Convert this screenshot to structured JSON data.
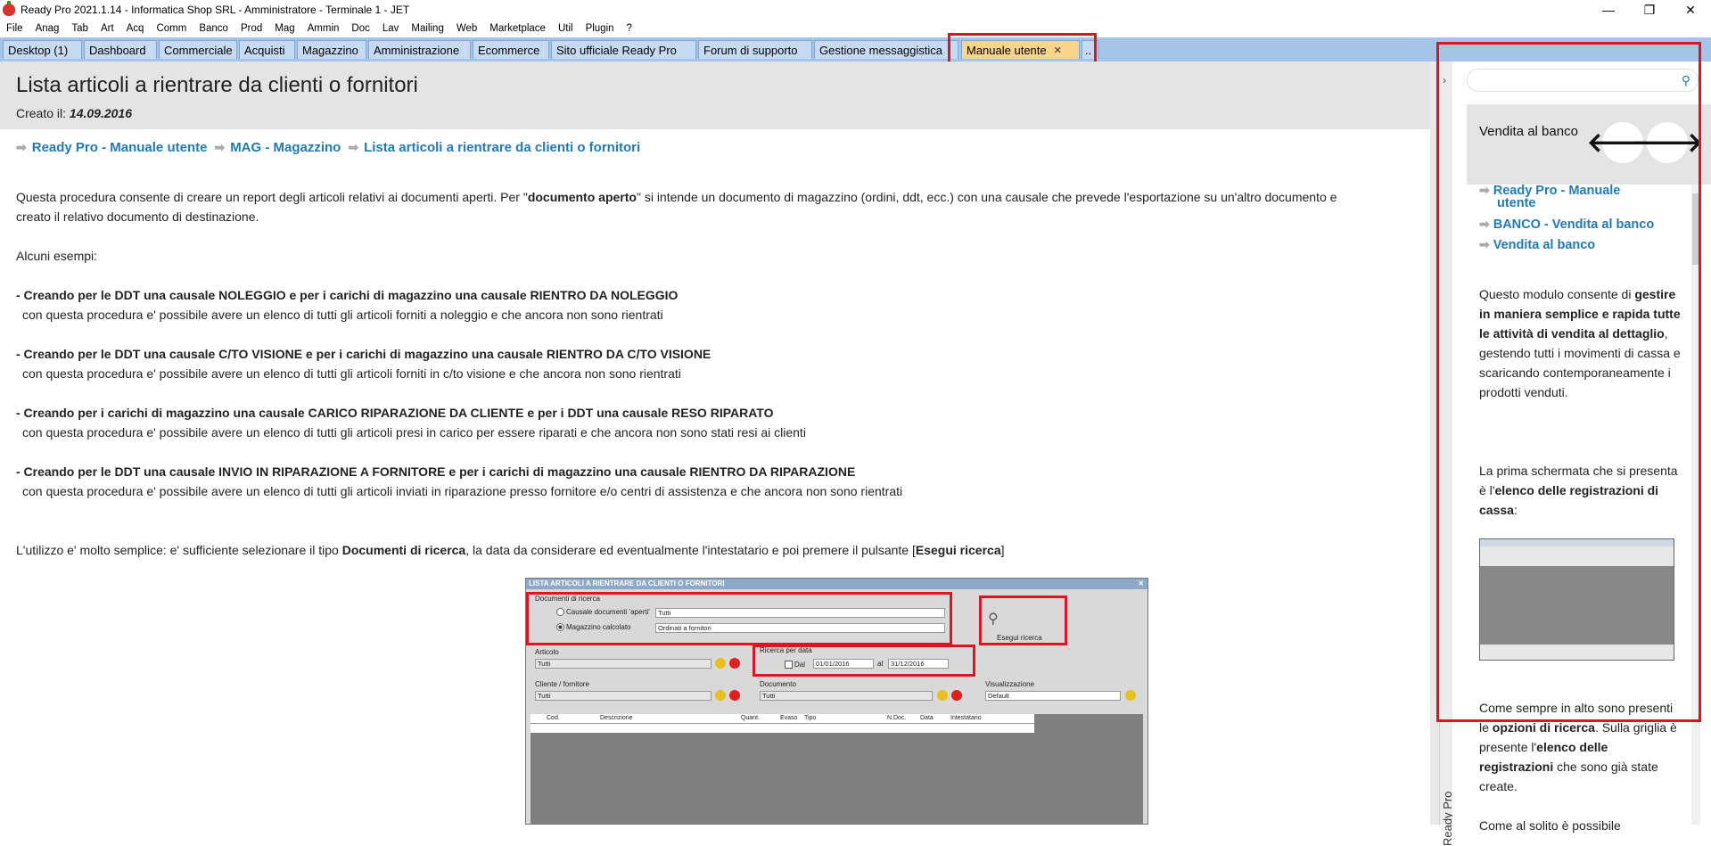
{
  "window": {
    "title": "Ready Pro 2021.1.14 - Informatica Shop SRL - Amministratore - Terminale 1 - JET",
    "min": "—",
    "max": "❐",
    "close": "✕"
  },
  "menu": [
    "File",
    "Anag",
    "Tab",
    "Art",
    "Acq",
    "Comm",
    "Banco",
    "Prod",
    "Mag",
    "Ammin",
    "Doc",
    "Lav",
    "Mailing",
    "Web",
    "Marketplace",
    "Util",
    "Plugin",
    "?"
  ],
  "tabs": [
    {
      "label": "Desktop (1)"
    },
    {
      "label": "Dashboard"
    },
    {
      "label": "Commerciale"
    },
    {
      "label": "Acquisti"
    },
    {
      "label": "Magazzino"
    },
    {
      "label": "Amministrazione"
    },
    {
      "label": "Ecommerce"
    },
    {
      "label": "Sito ufficiale Ready Pro"
    },
    {
      "label": "Forum di supporto"
    },
    {
      "label": "Gestione messaggistica"
    },
    {
      "label": "Manuale utente",
      "close": "✕"
    },
    {
      "label": ".."
    }
  ],
  "page": {
    "title": "Lista articoli a rientrare da clienti o fornitori",
    "created_label": "Creato il:",
    "created_date": "14.09.2016",
    "breadcrumb": [
      "Ready Pro - Manuale utente",
      "MAG - Magazzino",
      "Lista articoli a rientrare da clienti o fornitori"
    ],
    "intro_1a": "Questa procedura consente di creare un report degli articoli relativi ai documenti aperti. Per \"",
    "intro_1b": "documento aperto",
    "intro_1c": "\" si intende un documento di magazzino (ordini, ddt, ecc.) con una causale che prevede l'esportazione su un'altro documento e",
    "intro_2": "creato il relativo documento di destinazione.",
    "examples_label": "Alcuni esempi:",
    "examples": [
      {
        "title": "- Creando per le DDT una causale NOLEGGIO e per i carichi di magazzino una causale RIENTRO DA NOLEGGIO",
        "desc": "con questa procedura e' possibile avere un elenco di tutti gli articoli forniti a noleggio e che ancora non sono rientrati"
      },
      {
        "title": "- Creando per le DDT una causale C/TO VISIONE e per i carichi di magazzino una causale RIENTRO DA C/TO VISIONE",
        "desc": "con questa procedura e' possibile avere un elenco di tutti gli articoli forniti in c/to visione e che ancora non sono rientrati"
      },
      {
        "title": "- Creando per i carichi di magazzino una causale CARICO RIPARAZIONE DA CLIENTE e per i DDT una causale RESO RIPARATO",
        "desc": "con questa procedura e' possibile avere un elenco di tutti gli articoli presi in carico per essere riparati e che ancora non sono stati resi ai clienti"
      },
      {
        "title": "- Creando per le DDT una causale INVIO IN RIPARAZIONE A FORNITORE e per i carichi di magazzino una causale RIENTRO DA RIPARAZIONE",
        "desc": "con questa procedura e' possibile avere un elenco di tutti gli articoli inviati in riparazione presso fornitore e/o centri di assistenza e che ancora non sono rientrati"
      }
    ],
    "usage_a": "L'utilizzo e' molto semplice: e' sufficiente selezionare il tipo ",
    "usage_b": "Documenti di ricerca",
    "usage_c": ", la data da considerare ed eventualmente l'intestatario e poi premere il pulsante [",
    "usage_d": "Esegui ricerca",
    "usage_e": "]"
  },
  "screenshot": {
    "title": "LISTA ARTICOLI A RIENTRARE DA CLIENTI O FORNITORI",
    "close": "✕",
    "doc_group": "Documenti di ricerca",
    "opt_causale": "Causale documenti 'aperti'",
    "opt_causale_value": "Tutti",
    "opt_magazzino": "Magazzino calcolato",
    "opt_magazzino_value": "Ordinati a fornitori",
    "run_button": "Esegui ricerca",
    "articolo_label": "Articolo",
    "articolo_value": "Tutti",
    "date_group": "Ricerca per data",
    "dal_label": "Dal",
    "date_from": "01/01/2016",
    "al_label": "al",
    "date_to": "31/12/2016",
    "cliente_label": "Cliente / fornitore",
    "cliente_value": "Tutti",
    "documento_label": "Documento",
    "documento_value": "Tutti",
    "vis_label": "Visualizzazione",
    "vis_value": "Default",
    "columns": [
      "Cod.",
      "Descrizione",
      "Quant.",
      "Evaso",
      "Tipo",
      "N.Doc.",
      "Data",
      "Intestatario"
    ]
  },
  "right_panel": {
    "vertical_label": "Ready Pro",
    "title": "Vendita al banco",
    "prev": "🡐",
    "next": "🡒",
    "links": [
      "Ready Pro - Manuale",
      "utente",
      "BANCO - Vendita al banco",
      "Vendita al banco"
    ],
    "p1_a": "Questo modulo consente di ",
    "p1_b": "gestire in maniera semplice e rapida tutte le attività di vendita al dettaglio",
    "p1_c": ", gestendo tutti i movimenti di cassa e scaricando contemporaneamente i prodotti venduti.",
    "p2_a": "La prima schermata che si presenta è l'",
    "p2_b": "elenco delle registrazioni di cassa",
    "p2_c": ":",
    "p3_a": "Come sempre in alto sono presenti le ",
    "p3_b": "opzioni di ricerca",
    "p3_c": ". Sulla griglia è presente l'",
    "p3_d": "elenco delle registrazioni",
    "p3_e": " che sono già state create.",
    "p4": "Come al solito è possibile"
  },
  "colors": {
    "accent": "#1f7ab8",
    "highlight": "#e0141e",
    "tabbar": "#a5c5e8",
    "active_tab": "#f9d48b"
  }
}
